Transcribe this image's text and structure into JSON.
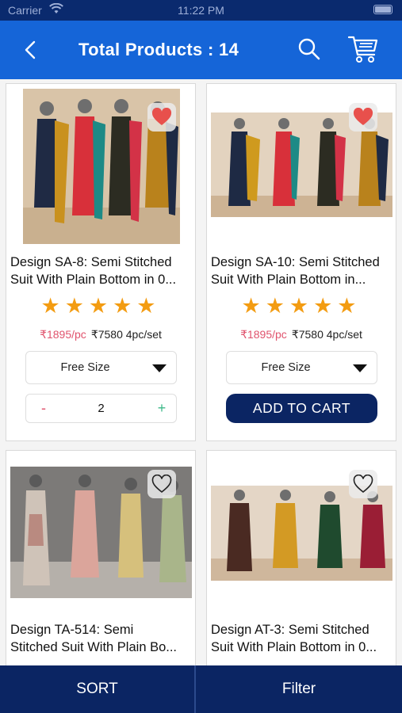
{
  "status_bar": {
    "carrier": "Carrier",
    "time": "11:22 PM"
  },
  "header": {
    "title": "Total Products : 14"
  },
  "products": [
    {
      "name_line1": "Design SA-8: Semi Stitched",
      "name_line2": "Suit With Plain Bottom in 0...",
      "rating": 5,
      "stars": "★★★★★",
      "price_per_piece": "₹1895/pc",
      "price_set": "₹7580 4pc/set",
      "size": "Free Size",
      "quantity": "2",
      "favorited": true
    },
    {
      "name_line1": "Design SA-10: Semi Stitched",
      "name_line2": "Suit With Plain Bottom  in...",
      "rating": 5,
      "stars": "★★★★★",
      "price_per_piece": "₹1895/pc",
      "price_set": "₹7580 4pc/set",
      "size": "Free Size",
      "add_to_cart": "ADD TO CART",
      "favorited": true
    },
    {
      "name_line1": "Design TA-514: Semi",
      "name_line2": "Stitched Suit With Plain Bo...",
      "favorited": false
    },
    {
      "name_line1": "Design AT-3: Semi Stitched",
      "name_line2": "Suit With Plain Bottom in 0...",
      "favorited": false
    }
  ],
  "bottom_bar": {
    "sort": "SORT",
    "filter": "Filter"
  },
  "colors": {
    "header": "#1565d8",
    "navy": "#0b2563",
    "star": "#f39c12",
    "price_accent": "#e0536d",
    "heart_active": "#e8504c"
  }
}
